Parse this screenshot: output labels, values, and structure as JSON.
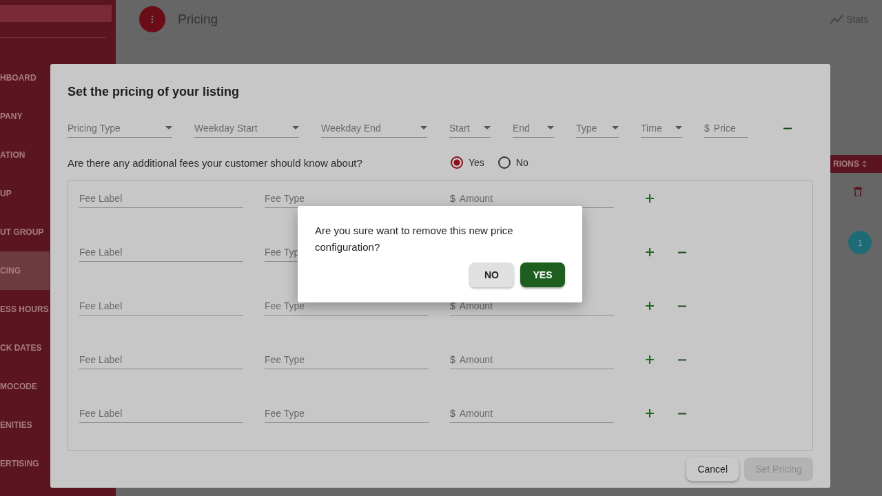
{
  "sidebar": {
    "items": [
      {
        "label": "HBOARD",
        "selected": false
      },
      {
        "label": "PANY",
        "selected": false
      },
      {
        "label": "ATION",
        "selected": false
      },
      {
        "label": "UP",
        "selected": false
      },
      {
        "label": "UT GROUP",
        "selected": false
      },
      {
        "label": "CING",
        "selected": true
      },
      {
        "label": "ESS HOURS",
        "selected": false
      },
      {
        "label": "CK DATES",
        "selected": false
      },
      {
        "label": "MOCODE",
        "selected": false
      },
      {
        "label": "ENITIES",
        "selected": false
      },
      {
        "label": "ERTISING",
        "selected": false
      }
    ]
  },
  "header": {
    "title": "Pricing",
    "stats_label": "Stats"
  },
  "background_table": {
    "column_label": "RIONS",
    "page": "1"
  },
  "modal": {
    "title": "Set the pricing of your listing",
    "pricing_fields": [
      {
        "kind": "dropdown",
        "label": "Pricing Type"
      },
      {
        "kind": "dropdown",
        "label": "Weekday Start"
      },
      {
        "kind": "dropdown",
        "label": "Weekday End"
      },
      {
        "kind": "dropdown",
        "label": "Start"
      },
      {
        "kind": "dropdown",
        "label": "End"
      },
      {
        "kind": "dropdown",
        "label": "Type"
      },
      {
        "kind": "dropdown",
        "label": "Time"
      },
      {
        "kind": "money",
        "currency": "$",
        "label": "Price"
      }
    ],
    "fees_question": "Are there any additional fees your customer should know about?",
    "fees_options": [
      {
        "label": "Yes",
        "selected": true
      },
      {
        "label": "No",
        "selected": false
      }
    ],
    "fee_rows": [
      {
        "label_placeholder": "Fee Label",
        "type_placeholder": "Fee Type",
        "currency": "$",
        "amount_placeholder": "Amount",
        "removable": false
      },
      {
        "label_placeholder": "Fee Label",
        "type_placeholder": "Fee Typ",
        "removable": true
      },
      {
        "label_placeholder": "Fee Label",
        "type_placeholder": "Fee Type",
        "currency": "$",
        "amount_placeholder": "Amount",
        "removable": true
      },
      {
        "label_placeholder": "Fee Label",
        "type_placeholder": "Fee Type",
        "currency": "$",
        "amount_placeholder": "Amount",
        "removable": true
      },
      {
        "label_placeholder": "Fee Label",
        "type_placeholder": "Fee Type",
        "currency": "$",
        "amount_placeholder": "Amount",
        "removable": true
      }
    ],
    "buttons": [
      {
        "label": "Cancel",
        "disabled": false
      },
      {
        "label": "Set Pricing",
        "disabled": true
      }
    ]
  },
  "confirm_dialog": {
    "message": "Are you sure want to remove this new price configuration?",
    "buttons": [
      {
        "label": "NO",
        "kind": "secondary"
      },
      {
        "label": "YES",
        "kind": "primary"
      }
    ]
  }
}
